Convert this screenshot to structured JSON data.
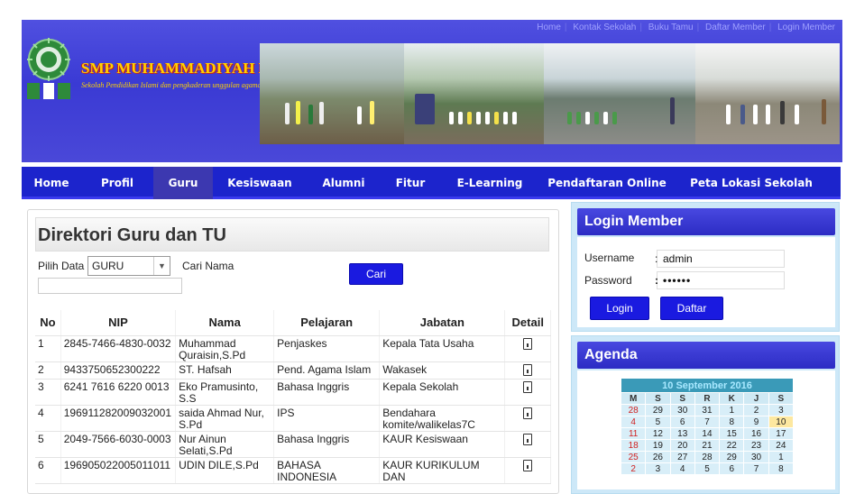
{
  "top_links": [
    "Home",
    "Kontak Sekolah",
    "Buku Tamu",
    "Daftar Member",
    "Login Member"
  ],
  "school": {
    "name": "SMP MUHAMMADIYAH KUPANG",
    "tagline": "Sekolah Pendidikan Islami dan pengkaderan unggulan agama"
  },
  "nav": [
    "Home",
    "Profil",
    "Guru",
    "Kesiswaan",
    "Alumni",
    "Fitur",
    "E-Learning",
    "Pendaftaran Online",
    "Peta Lokasi Sekolah"
  ],
  "nav_active": "Guru",
  "main": {
    "title": "Direktori Guru dan TU",
    "pilih_label": "Pilih Data",
    "pilih_value": "GURU",
    "cari_label": "Cari Nama",
    "cari_button": "Cari",
    "columns": [
      "No",
      "NIP",
      "Nama",
      "Pelajaran",
      "Jabatan",
      "Detail"
    ],
    "rows": [
      [
        "1",
        "2845-7466-4830-0032",
        "Muhammad Quraisin,S.Pd",
        "Penjaskes",
        "Kepala Tata Usaha"
      ],
      [
        "2",
        "9433750652300222",
        "ST. Hafsah",
        "Pend. Agama Islam",
        "Wakasek"
      ],
      [
        "3",
        "6241 7616 6220 0013",
        "Eko Pramusinto, S.S",
        "Bahasa Inggris",
        "Kepala Sekolah"
      ],
      [
        "4",
        "196911282009032001",
        "saida Ahmad Nur, S.Pd",
        "IPS",
        "Bendahara komite/walikelas7C"
      ],
      [
        "5",
        "2049-7566-6030-0003",
        "Nur Ainun Selati,S.Pd",
        "Bahasa Inggris",
        "KAUR Kesiswaan"
      ],
      [
        "6",
        "196905022005011011",
        "UDIN DILE,S.Pd",
        "BAHASA INDONESIA",
        "KAUR KURIKULUM DAN"
      ]
    ],
    "detail_icon": "document-icon"
  },
  "login": {
    "title": "Login Member",
    "username_label": "Username",
    "username_value": "admin",
    "password_label": "Password",
    "password_value": "••••••",
    "login_button": "Login",
    "daftar_button": "Daftar"
  },
  "agenda": {
    "title": "Agenda",
    "month_label": "10 September 2016",
    "weekdays": [
      "M",
      "S",
      "S",
      "R",
      "K",
      "J",
      "S"
    ],
    "weeks": [
      [
        "28",
        "29",
        "30",
        "31",
        "1",
        "2",
        "3"
      ],
      [
        "4",
        "5",
        "6",
        "7",
        "8",
        "9",
        "10"
      ],
      [
        "11",
        "12",
        "13",
        "14",
        "15",
        "16",
        "17"
      ],
      [
        "18",
        "19",
        "20",
        "21",
        "22",
        "23",
        "24"
      ],
      [
        "25",
        "26",
        "27",
        "28",
        "29",
        "30",
        "1"
      ],
      [
        "2",
        "3",
        "4",
        "5",
        "6",
        "7",
        "8"
      ]
    ],
    "today": "10"
  },
  "colors": {
    "header_blue": "#4a48d8",
    "nav_blue": "#1c24cc",
    "button_blue": "#1a1ae0",
    "school_name_yellow": "#ffd200",
    "sidebar_bg": "#cde8f8"
  }
}
